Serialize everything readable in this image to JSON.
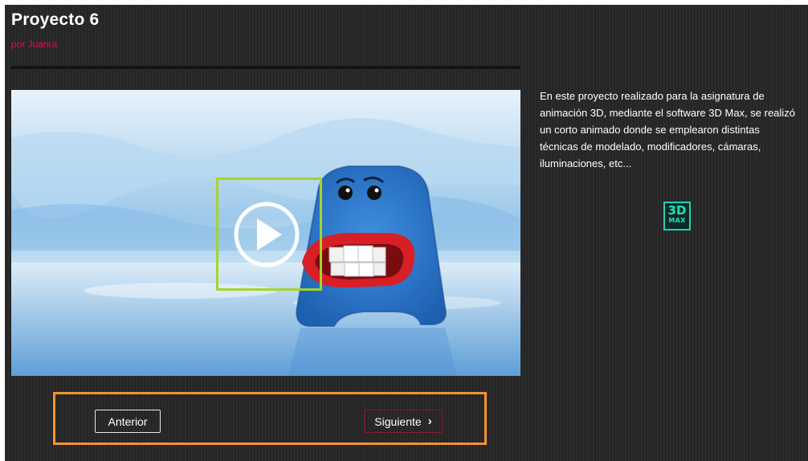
{
  "project": {
    "title": "Proyecto 6",
    "author": "por Juanra"
  },
  "video": {
    "play_icon": "play-circle-icon",
    "thumbnail": "blue sponge monster with red lips and white teeth"
  },
  "navigation": {
    "prev_label": "Anterior",
    "next_label": "Siguiente",
    "next_icon": "chevron-right-icon"
  },
  "description": {
    "text": "En este proyecto realizado para la asignatura de animación 3D, mediante el software 3D Max, se realizó un corto animado donde se emplearon distintas técnicas de modelado, modificadores, cámaras, iluminaciones, etc..."
  },
  "software_logo": {
    "line1": "3D",
    "line2": "MAX",
    "color": "#1fe0bf"
  },
  "colors": {
    "background": "#262626",
    "accent": "#d3144a",
    "highlight_green": "#a6d42a",
    "highlight_orange": "#f39230"
  }
}
